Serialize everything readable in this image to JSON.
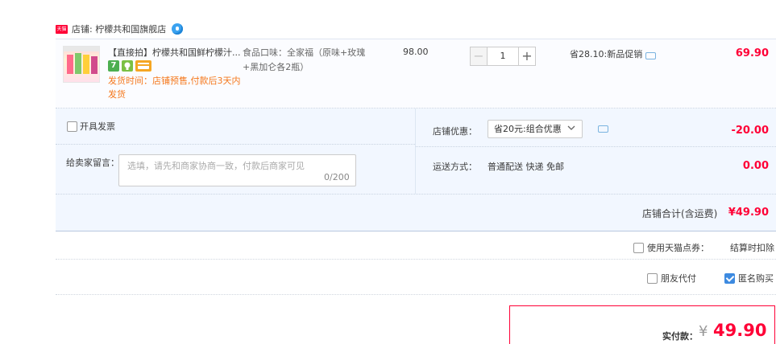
{
  "shop": {
    "name": "店铺: 柠檬共和国旗舰店",
    "platform_badge": "天猫"
  },
  "item": {
    "title": "【直接拍】柠檬共和国鲜柠檬汁...",
    "badges": [
      "7",
      "bulb-icon",
      "card-icon"
    ],
    "ship_note": "发货时间：店铺预售,付款后3天内发货",
    "flavor": "食品口味：全家福（原味+玫瑰+黑加仑各2瓶）",
    "unit_price": "98.00",
    "quantity": "1",
    "promo": "省28.10:新品促销",
    "subtotal": "69.90"
  },
  "options": {
    "invoice_label": "开具发票",
    "message_label": "给卖家留言：",
    "message_placeholder": "选填，请先和商家协商一致，付款后商家可见",
    "message_count": "0/200",
    "shop_discount_label": "店铺优惠：",
    "shop_discount_select": "省20元:组合优惠",
    "shop_discount_value": "-20.00",
    "shipping_label": "运送方式：",
    "shipping_method": "普通配送 快递 免邮",
    "shipping_value": "0.00"
  },
  "total": {
    "label": "店铺合计(含运费)",
    "value": "¥49.90"
  },
  "points": {
    "label": "使用天猫点券：",
    "value": "结算时扣除"
  },
  "payment": {
    "friend_pay": "朋友代付",
    "anonymous": "匿名购买"
  },
  "final": {
    "label": "实付款：",
    "currency": "¥",
    "value": "49.90"
  },
  "colors": {
    "price_red": "#ff0036",
    "accent_blue": "#3d8ae0",
    "row_bg": "#f2f7ff",
    "ship_note_orange": "#f5781d"
  }
}
